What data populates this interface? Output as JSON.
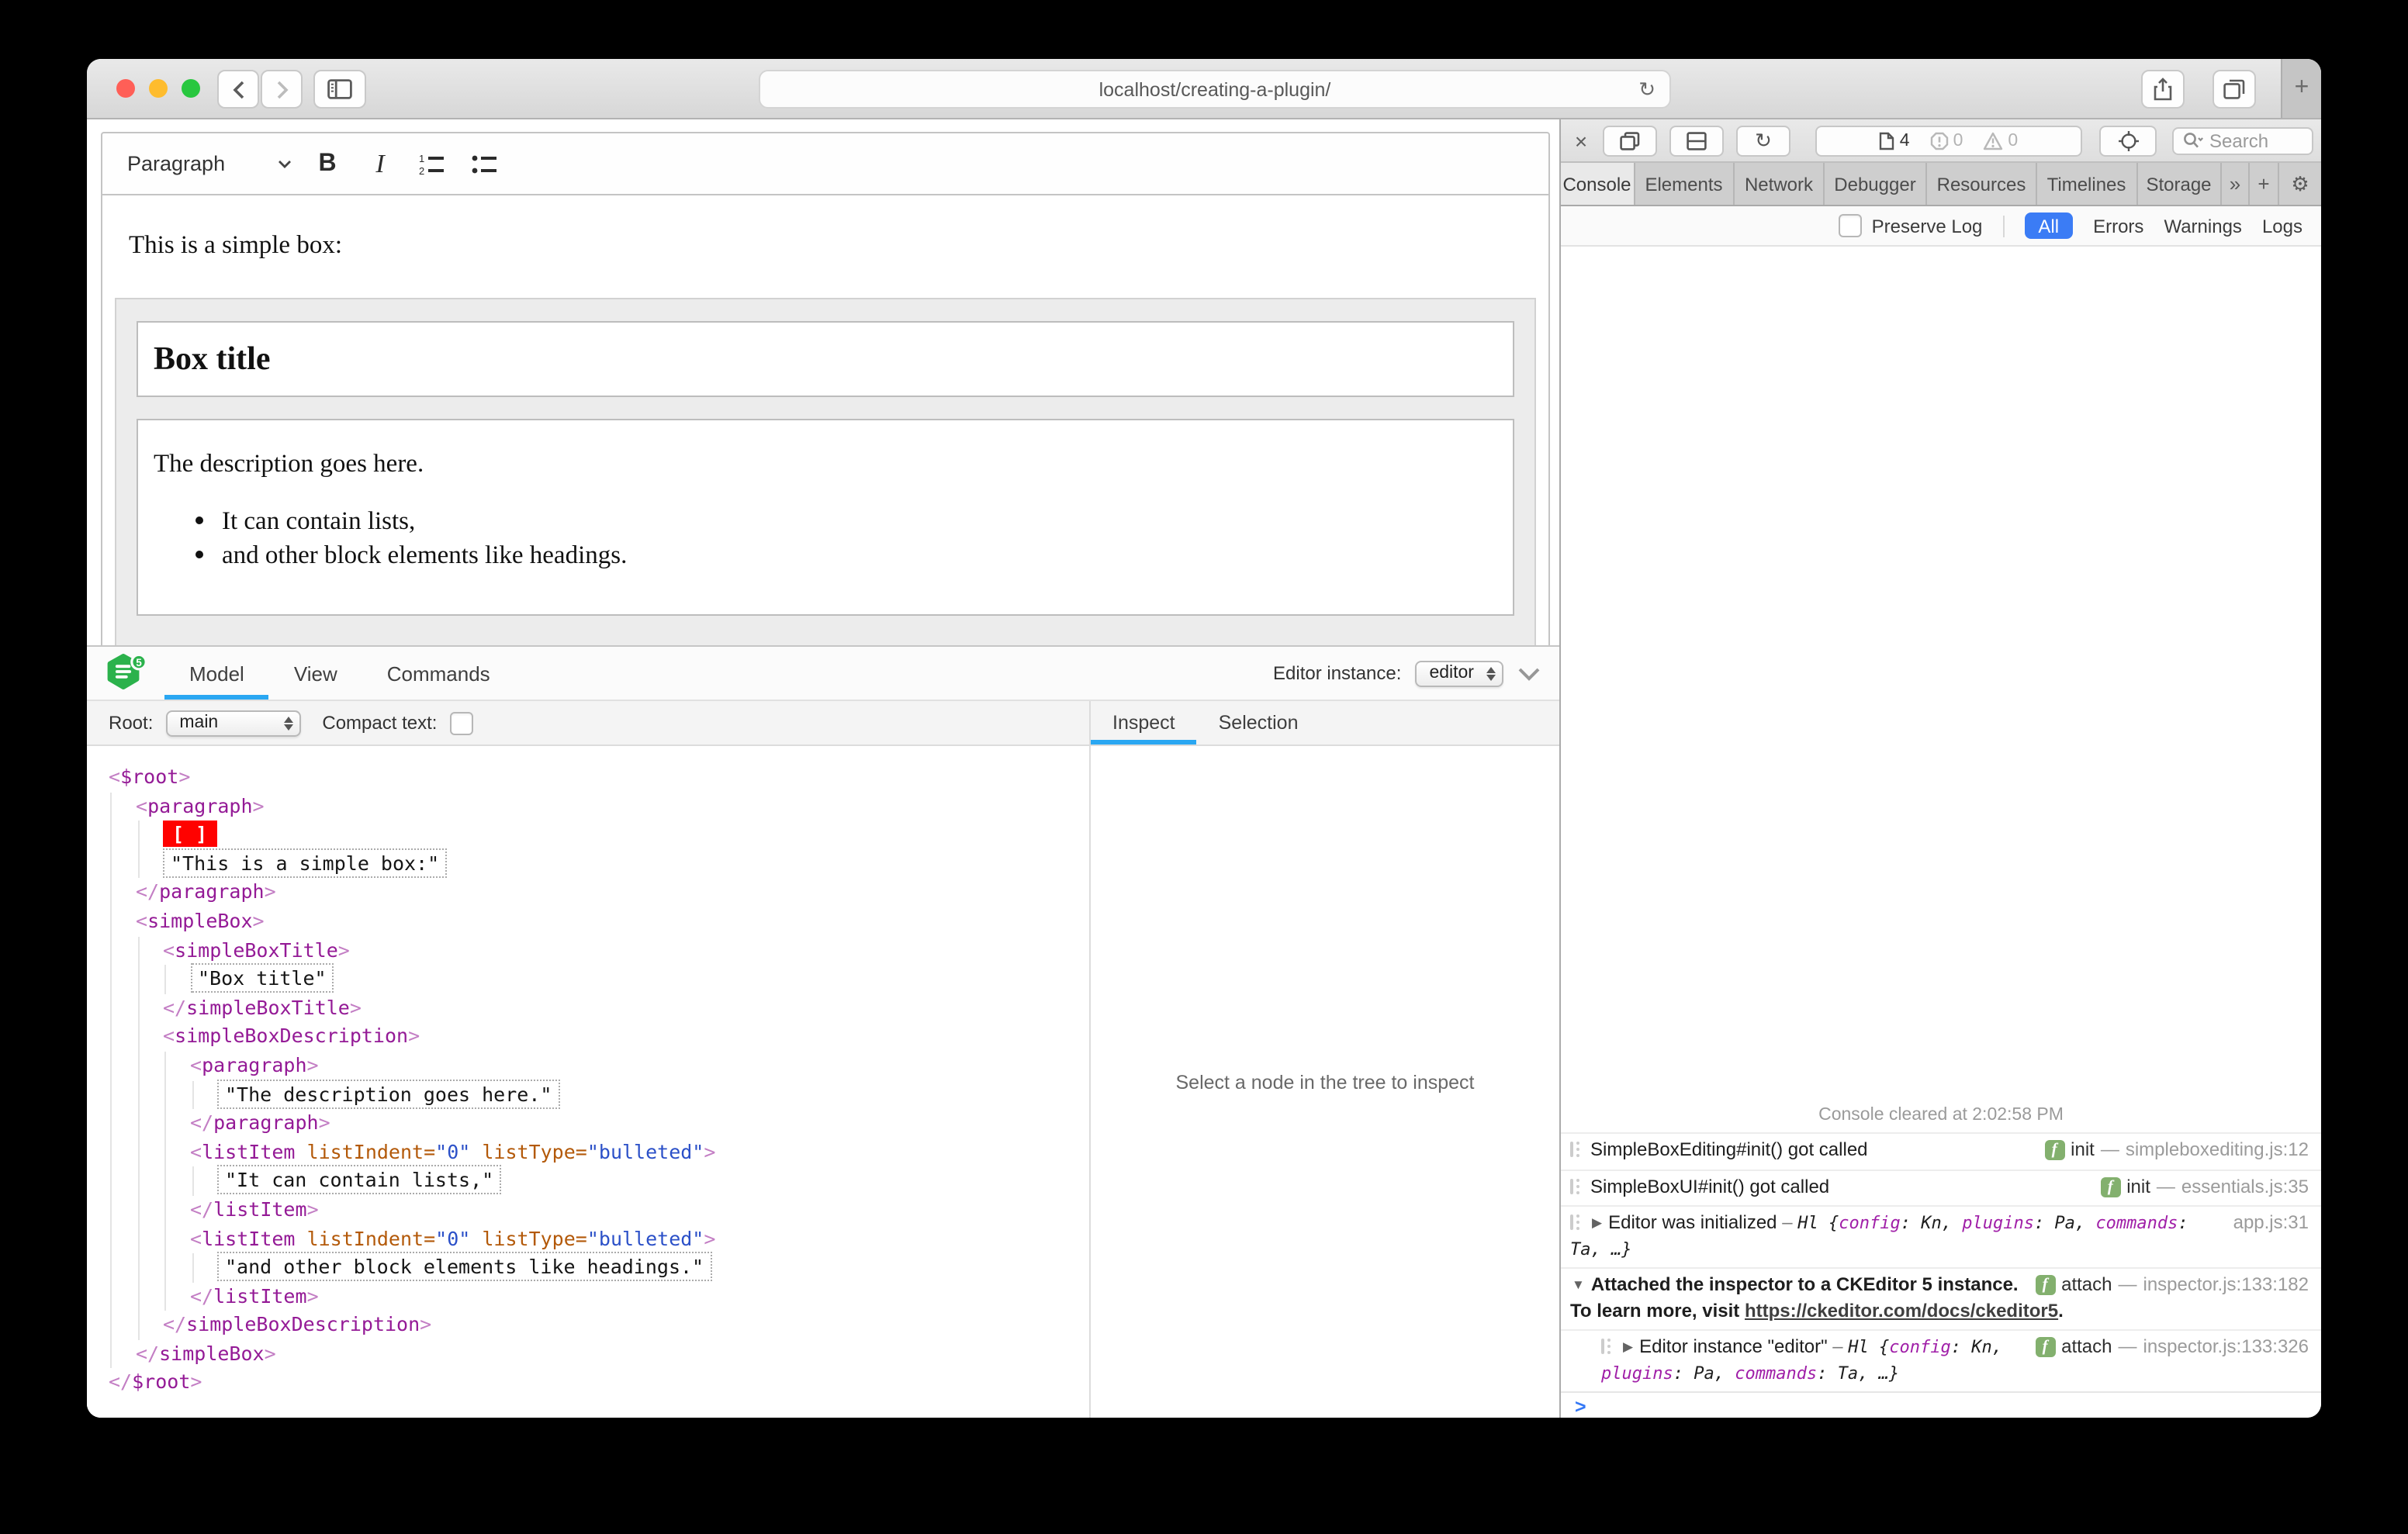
{
  "browser": {
    "url": "localhost/creating-a-plugin/",
    "new_tab_label": "+",
    "reload_icon": "↻"
  },
  "editor": {
    "toolbar": {
      "heading_dropdown": "Paragraph",
      "bold_label": "B",
      "italic_label": "I"
    },
    "content": {
      "intro": "This is a simple box:",
      "box_title": "Box title",
      "description": "The description goes here.",
      "list_items": [
        "It can contain lists,",
        "and other block elements like headings."
      ]
    }
  },
  "ck_inspector": {
    "logo_badge": "5",
    "tabs": [
      {
        "label": "Model",
        "active": true
      },
      {
        "label": "View",
        "active": false
      },
      {
        "label": "Commands",
        "active": false
      }
    ],
    "editor_instance_label": "Editor instance:",
    "editor_instance_value": "editor",
    "root_label": "Root:",
    "root_value": "main",
    "compact_text_label": "Compact text:",
    "pane_tabs": [
      {
        "label": "Inspect",
        "active": true
      },
      {
        "label": "Selection",
        "active": false
      }
    ],
    "empty_message": "Select a node in the tree to inspect",
    "accent_color": "#2aa7f2",
    "marker_color": "#ff0200",
    "tree": [
      {
        "t": "open",
        "level": 0,
        "name": "$root"
      },
      {
        "t": "open",
        "level": 1,
        "name": "paragraph"
      },
      {
        "t": "marker",
        "level": 2,
        "text": "[ ]"
      },
      {
        "t": "text",
        "level": 2,
        "text": "\"This is a simple box:\""
      },
      {
        "t": "close",
        "level": 1,
        "name": "paragraph"
      },
      {
        "t": "open",
        "level": 1,
        "name": "simpleBox"
      },
      {
        "t": "open",
        "level": 2,
        "name": "simpleBoxTitle"
      },
      {
        "t": "text",
        "level": 3,
        "text": "\"Box title\""
      },
      {
        "t": "close",
        "level": 2,
        "name": "simpleBoxTitle"
      },
      {
        "t": "open",
        "level": 2,
        "name": "simpleBoxDescription"
      },
      {
        "t": "open",
        "level": 3,
        "name": "paragraph"
      },
      {
        "t": "text",
        "level": 4,
        "text": "\"The description goes here.\""
      },
      {
        "t": "close",
        "level": 3,
        "name": "paragraph"
      },
      {
        "t": "open",
        "level": 3,
        "name": "listItem",
        "attrs": [
          [
            "listIndent",
            "0"
          ],
          [
            "listType",
            "bulleted"
          ]
        ]
      },
      {
        "t": "text",
        "level": 4,
        "text": "\"It can contain lists,\""
      },
      {
        "t": "close",
        "level": 3,
        "name": "listItem"
      },
      {
        "t": "open",
        "level": 3,
        "name": "listItem",
        "attrs": [
          [
            "listIndent",
            "0"
          ],
          [
            "listType",
            "bulleted"
          ]
        ]
      },
      {
        "t": "text",
        "level": 4,
        "text": "\"and other block elements like headings.\""
      },
      {
        "t": "close",
        "level": 3,
        "name": "listItem"
      },
      {
        "t": "close",
        "level": 2,
        "name": "simpleBoxDescription"
      },
      {
        "t": "close",
        "level": 1,
        "name": "simpleBox"
      },
      {
        "t": "close",
        "level": 0,
        "name": "$root"
      }
    ]
  },
  "web_inspector": {
    "close_label": "×",
    "reload_icon": "↻",
    "page_count": "4",
    "error_count": "0",
    "warning_count": "0",
    "search_placeholder": "Search",
    "tabs": [
      "Console",
      "Elements",
      "Network",
      "Debugger",
      "Resources",
      "Timelines",
      "Storage"
    ],
    "active_tab": "Console",
    "overflow_label": "»",
    "add_tab_label": "+",
    "settings_icon": "⚙",
    "filter": {
      "preserve_log_label": "Preserve Log",
      "scopes": [
        "All",
        "Errors",
        "Warnings",
        "Logs"
      ],
      "active_scope": "All"
    },
    "console": {
      "cleared_message": "Console cleared at 2:02:58 PM",
      "prompt": ">",
      "rows": [
        {
          "icon": true,
          "text": "SimpleBoxEditing#init() got called",
          "badge": "f",
          "fn": "init",
          "loc": "simpleboxediting.js:12"
        },
        {
          "icon": true,
          "text": "SimpleBoxUI#init() got called",
          "badge": "f",
          "fn": "init",
          "loc": "essentials.js:35"
        },
        {
          "icon": true,
          "arrow": "closed",
          "text": "Editor was initialized",
          "obj": {
            "prefix": "Hl {",
            "pairs": [
              [
                "config",
                "Kn"
              ],
              [
                "plugins",
                "Pa"
              ],
              [
                "commands",
                "Ta"
              ]
            ],
            "suffix": ", …}"
          },
          "loc": "app.js:31"
        },
        {
          "arrow": "open",
          "bold": true,
          "text": "Attached the inspector to a CKEditor 5 instance. To learn more, visit",
          "link": "https://ckeditor.com/docs/ckeditor5",
          "suffix_text": ".",
          "badge": "f",
          "fn": "attach",
          "loc": "inspector.js:133:182"
        },
        {
          "icon": true,
          "arrow": "closed",
          "indent": true,
          "text": "Editor instance \"editor\"",
          "obj": {
            "prefix": "Hl {",
            "pairs": [
              [
                "config",
                "Kn"
              ],
              [
                "plugins",
                "Pa"
              ],
              [
                "commands",
                "Ta"
              ]
            ],
            "suffix": ", …}"
          },
          "badge": "f",
          "fn": "attach",
          "loc": "inspector.js:133:326"
        }
      ]
    }
  }
}
